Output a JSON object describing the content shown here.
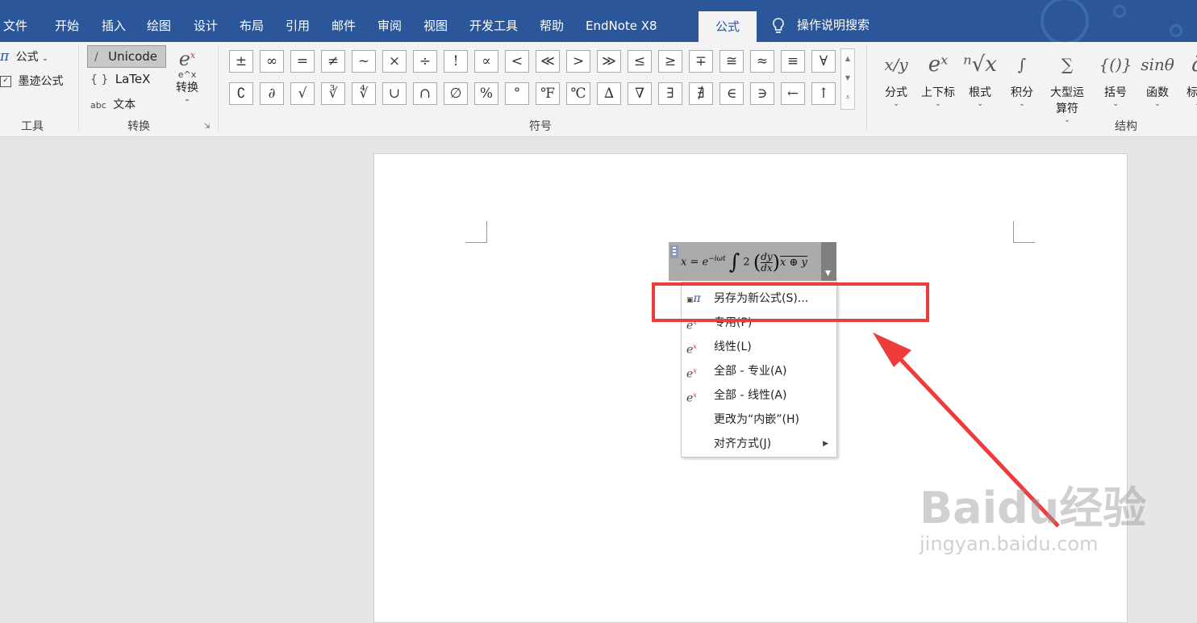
{
  "tabs": [
    "文件",
    "开始",
    "插入",
    "绘图",
    "设计",
    "布局",
    "引用",
    "邮件",
    "审阅",
    "视图",
    "开发工具",
    "帮助",
    "EndNote X8",
    "公式"
  ],
  "active_tab": "公式",
  "search_label": "操作说明搜索",
  "tools_group": {
    "label": "工具",
    "formula_label": "公式",
    "ink_label": "墨迹公式"
  },
  "convert_group": {
    "label": "转换",
    "unicode_label": "Unicode",
    "latex_label": "LaTeX",
    "text_label": "文本",
    "convert_label": "转换"
  },
  "symbols_group": {
    "label": "符号",
    "row1": [
      "±",
      "∞",
      "=",
      "≠",
      "~",
      "×",
      "÷",
      "!",
      "∝",
      "<",
      "≪",
      ">",
      "≫",
      "≤",
      "≥",
      "∓",
      "≅",
      "≈",
      "≡",
      "∀"
    ],
    "row2": [
      "∁",
      "∂",
      "√",
      "∛",
      "∜",
      "∪",
      "∩",
      "∅",
      "%",
      "°",
      "℉",
      "℃",
      "∆",
      "∇",
      "∃",
      "∄",
      "∈",
      "∋",
      "←",
      "↑"
    ]
  },
  "structures_group": {
    "label": "结构",
    "items": [
      {
        "label": "分式",
        "glyph": "x/y"
      },
      {
        "label": "上下标",
        "glyph": "eˣ"
      },
      {
        "label": "根式",
        "glyph": "ⁿ√x"
      },
      {
        "label": "积分",
        "glyph": "∫"
      },
      {
        "label": "大型运算符",
        "glyph": "∑"
      },
      {
        "label": "括号",
        "glyph": "{()}"
      },
      {
        "label": "函数",
        "glyph": "sinθ"
      },
      {
        "label": "标注",
        "glyph": "ä"
      }
    ]
  },
  "equation": "x = e^{−iωt} ∫ 2 (dy/dx) x ⊕ y",
  "context_menu": [
    {
      "label": "另存为新公式(S)...",
      "icon": "save-equation-icon"
    },
    {
      "label": "专用(P)",
      "icon": "professional-icon"
    },
    {
      "label": "线性(L)",
      "icon": "linear-icon"
    },
    {
      "label": "全部 - 专业(A)",
      "icon": "all-professional-icon"
    },
    {
      "label": "全部 - 线性(A)",
      "icon": "all-linear-icon"
    },
    {
      "label": "更改为“内嵌”(H)",
      "icon": ""
    },
    {
      "label": "对齐方式(J)",
      "icon": "",
      "submenu": true
    }
  ],
  "colors": {
    "ribbon_blue": "#2b579a",
    "annotation_red": "#ee3b3b"
  },
  "watermark": {
    "brand": "Baidu经验",
    "url": "jingyan.baidu.com"
  }
}
